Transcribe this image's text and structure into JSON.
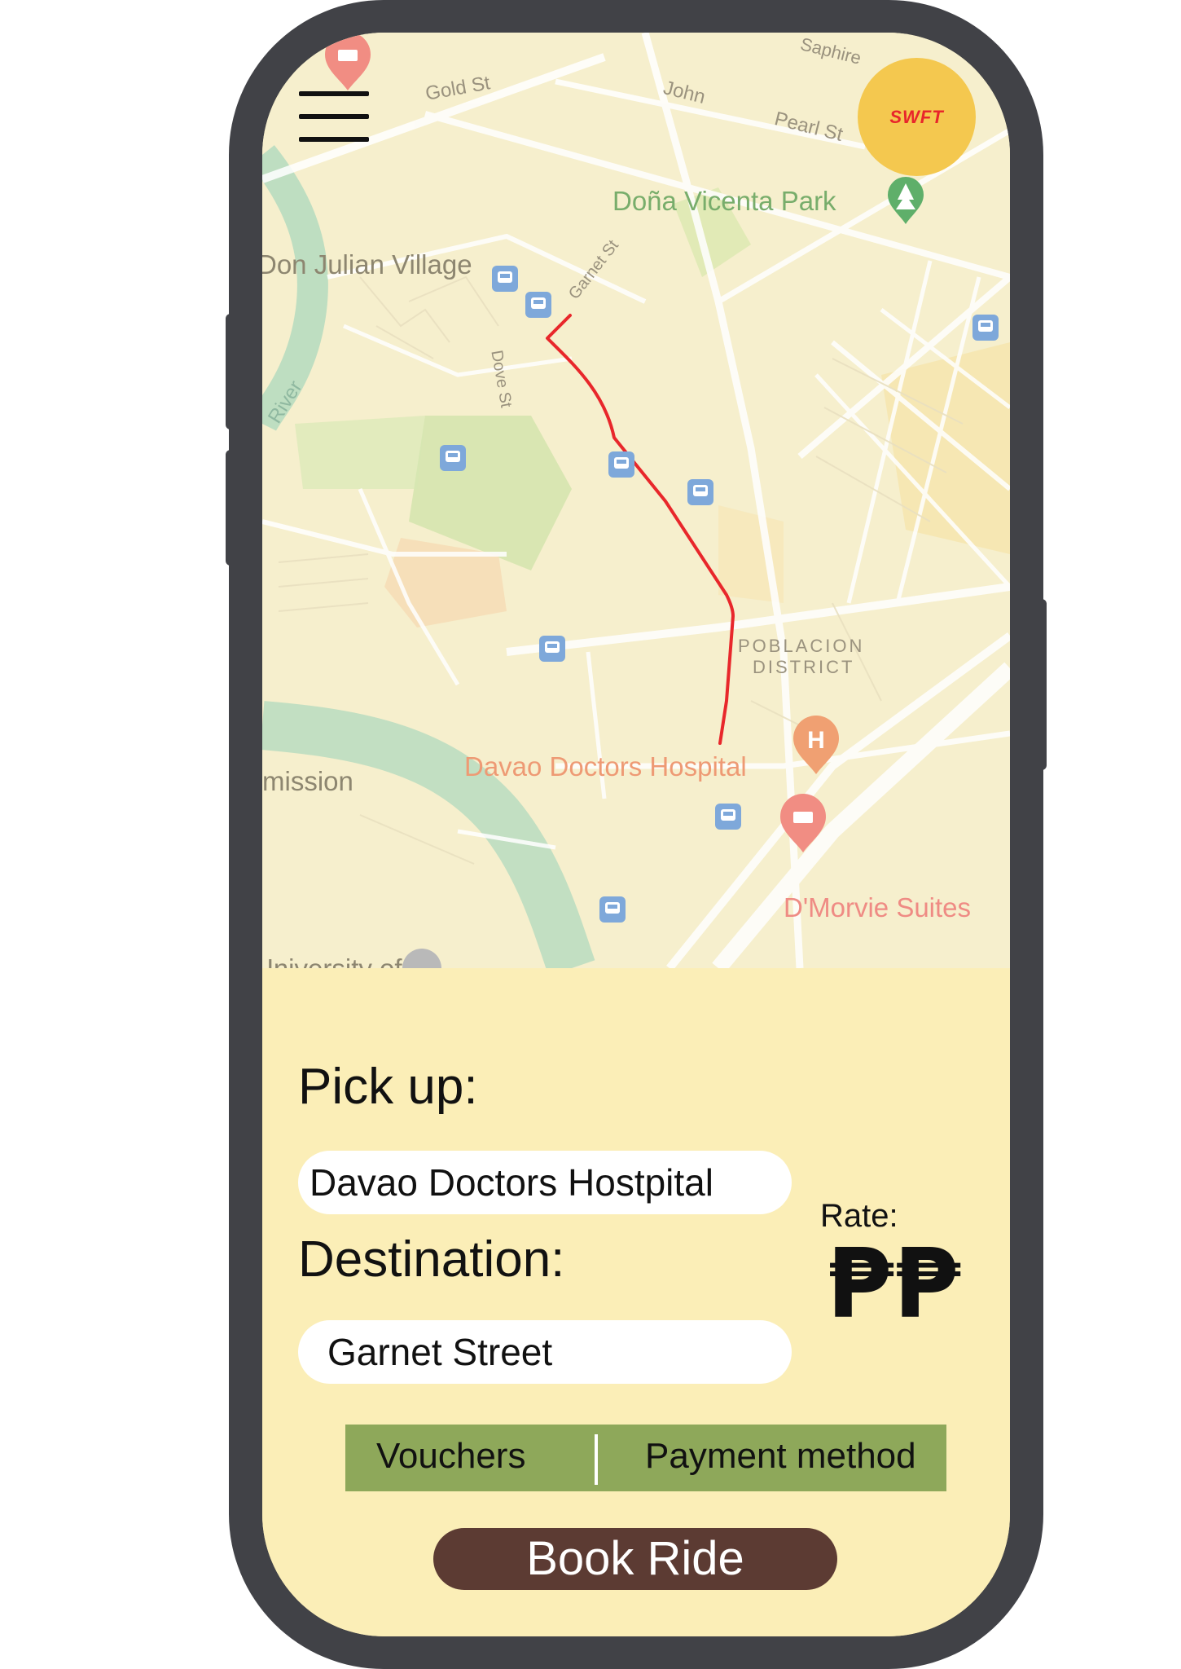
{
  "app": {
    "logo_text": "SWFT"
  },
  "map": {
    "places": {
      "dona_vicenta_park": "Doña Vicenta Park",
      "don_julian_village": "Don Julian Village",
      "poblacion_line1": "POBLACION",
      "poblacion_line2": "DISTRICT",
      "davao_doctors_hospital": "Davao Doctors Hospital",
      "dmorvie_suites": "D'Morvie Suites",
      "mission": "mission",
      "university": "University of"
    },
    "streets": {
      "gold": "Gold St",
      "john": "John",
      "pearl": "Pearl St",
      "saphire": "Saphire",
      "dove": "Dove St",
      "garnet": "Garnet St",
      "river": "River"
    },
    "colors": {
      "route": "#e8272b",
      "river": "#b8dcc0",
      "park": "#cde3a9",
      "road": "#ffffff",
      "background": "#f6efcd",
      "poi_red": "#f18d83",
      "bus_blue": "#7ea8da",
      "park_green": "#5faf6a"
    }
  },
  "booking": {
    "pickup_label": "Pick up:",
    "pickup_value": "Davao Doctors Hostpital",
    "destination_label": "Destination:",
    "destination_value": "Garnet Street",
    "rate_label": "Rate:",
    "rate_value": "₱₱",
    "vouchers_label": "Vouchers",
    "payment_label": "Payment method",
    "book_button": "Book Ride"
  },
  "colors": {
    "panel_bg": "#fbeeb7",
    "options_bar": "#8ea85a",
    "book_button_bg": "#5c3b33",
    "logo_bg": "#f4c84f",
    "logo_text": "#e8262b",
    "phone_frame": "#414247"
  }
}
